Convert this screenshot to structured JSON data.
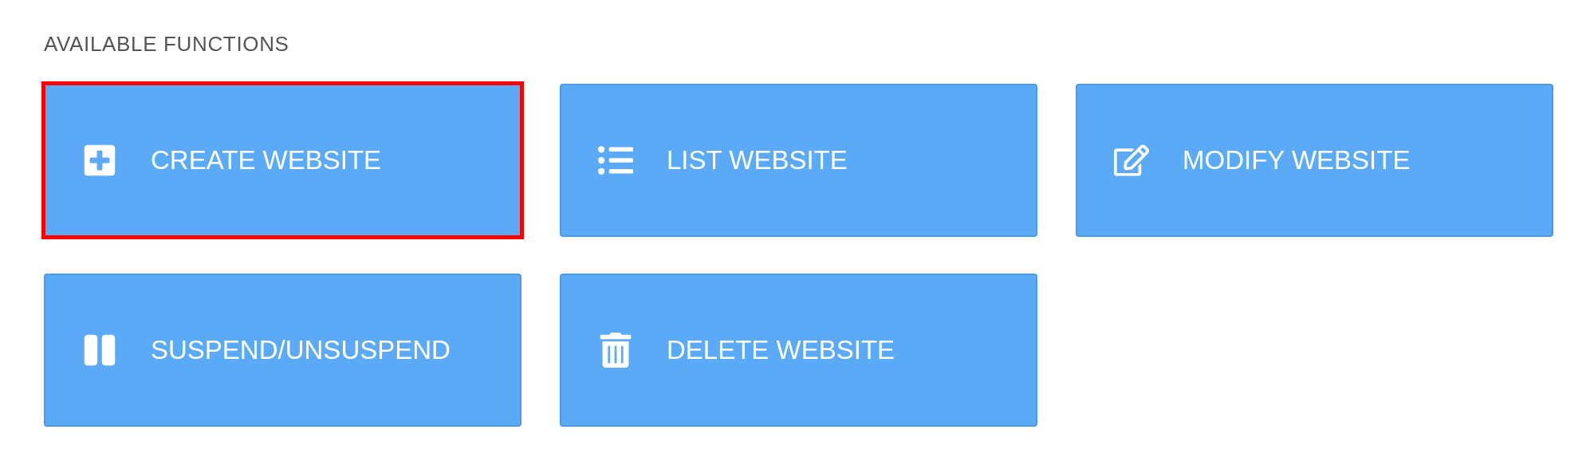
{
  "section": {
    "title": "AVAILABLE FUNCTIONS"
  },
  "functions": [
    {
      "label": "CREATE WEBSITE",
      "kind": "create",
      "selected": true
    },
    {
      "label": "LIST WEBSITE",
      "kind": "list",
      "selected": false
    },
    {
      "label": "MODIFY WEBSITE",
      "kind": "modify",
      "selected": false
    },
    {
      "label": "SUSPEND/UNSUSPEND",
      "kind": "suspend",
      "selected": false
    },
    {
      "label": "DELETE WEBSITE",
      "kind": "delete",
      "selected": false
    }
  ]
}
